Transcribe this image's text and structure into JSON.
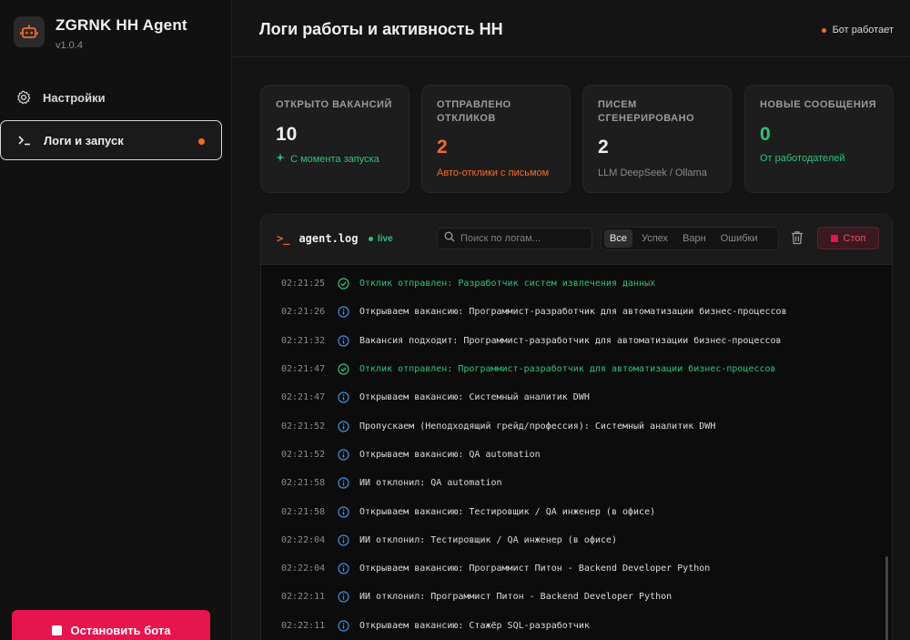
{
  "app": {
    "name": "ZGRNK HH Agent",
    "version": "v1.0.4"
  },
  "sidebar": {
    "items": [
      {
        "label": "Настройки",
        "icon": "gear-icon"
      },
      {
        "label": "Логи и запуск",
        "icon": "terminal-icon",
        "active": true
      }
    ],
    "stop_button": "Остановить бота"
  },
  "header": {
    "title": "Логи работы и активность HH",
    "status": "Бот работает"
  },
  "stats": [
    {
      "label": "Открыто вакансий",
      "value": "10",
      "sub": "С момента запуска",
      "value_color": "#f2f2f2",
      "sub_color": "#2fc27b"
    },
    {
      "label": "Отправлено откликов",
      "value": "2",
      "sub": "Авто-отклики с письмом",
      "value_color": "#f26b2a",
      "sub_color": "#f26b2a"
    },
    {
      "label": "Писем сгенерировано",
      "value": "2",
      "sub": "LLM DeepSeek / Ollama",
      "value_color": "#f2f2f2",
      "sub_color": "#8a8a8a"
    },
    {
      "label": "Новые сообщения",
      "value": "0",
      "sub": "От работодателей",
      "value_color": "#2fc27b",
      "sub_color": "#2fc27b"
    }
  ],
  "log": {
    "file": "agent.log",
    "live": "live",
    "search_placeholder": "Поиск по логам...",
    "filters": [
      "Все",
      "Успех",
      "Варн",
      "Ошибки"
    ],
    "stop_label": "Стоп",
    "lines": [
      {
        "time": "02:21:25",
        "type": "success",
        "text": "Отклик отправлен: Разработчик систем извлечения данных"
      },
      {
        "time": "02:21:26",
        "type": "info",
        "text": "Открываем вакансию: Программист-разработчик для автоматизации бизнес-процессов"
      },
      {
        "time": "02:21:32",
        "type": "info",
        "text": "Вакансия подходит: Программист-разработчик для автоматизации бизнес-процессов"
      },
      {
        "time": "02:21:47",
        "type": "success",
        "text": "Отклик отправлен: Программист-разработчик для автоматизации бизнес-процессов"
      },
      {
        "time": "02:21:47",
        "type": "info",
        "text": "Открываем вакансию: Системный аналитик DWH"
      },
      {
        "time": "02:21:52",
        "type": "info",
        "text": "Пропускаем (Неподходящий грейд/профессия): Системный аналитик DWH"
      },
      {
        "time": "02:21:52",
        "type": "info",
        "text": "Открываем вакансию: QA automation"
      },
      {
        "time": "02:21:58",
        "type": "info",
        "text": "ИИ отклонил: QA automation"
      },
      {
        "time": "02:21:58",
        "type": "info",
        "text": "Открываем вакансию: Тестировщик / QA инженер (в офисе)"
      },
      {
        "time": "02:22:04",
        "type": "info",
        "text": "ИИ отклонил: Тестировщик / QA инженер (в офисе)"
      },
      {
        "time": "02:22:04",
        "type": "info",
        "text": "Открываем вакансию: Программист Питон - Backend Developer Python"
      },
      {
        "time": "02:22:11",
        "type": "info",
        "text": "ИИ отклонил: Программист Питон - Backend Developer Python"
      },
      {
        "time": "02:22:11",
        "type": "info",
        "text": "Открываем вакансию: Стажёр SQL-разработчик"
      }
    ]
  }
}
